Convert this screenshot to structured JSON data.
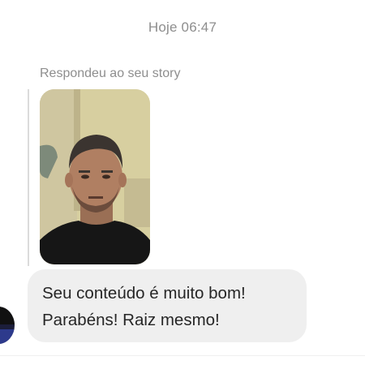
{
  "thread": {
    "timestamp": "Hoje 06:47"
  },
  "story_reply": {
    "label": "Respondeu ao seu story",
    "thumbnail_icon": "story-video-thumbnail"
  },
  "message": {
    "lines": [
      "Seu conteúdo é muito bom!",
      "Parabéns! Raiz mesmo!"
    ]
  },
  "colors": {
    "background": "#ffffff",
    "bubble": "#efefef",
    "meta_text": "#8e8e8e",
    "message_text": "#262626",
    "reply_bar": "#dbdbdb"
  }
}
